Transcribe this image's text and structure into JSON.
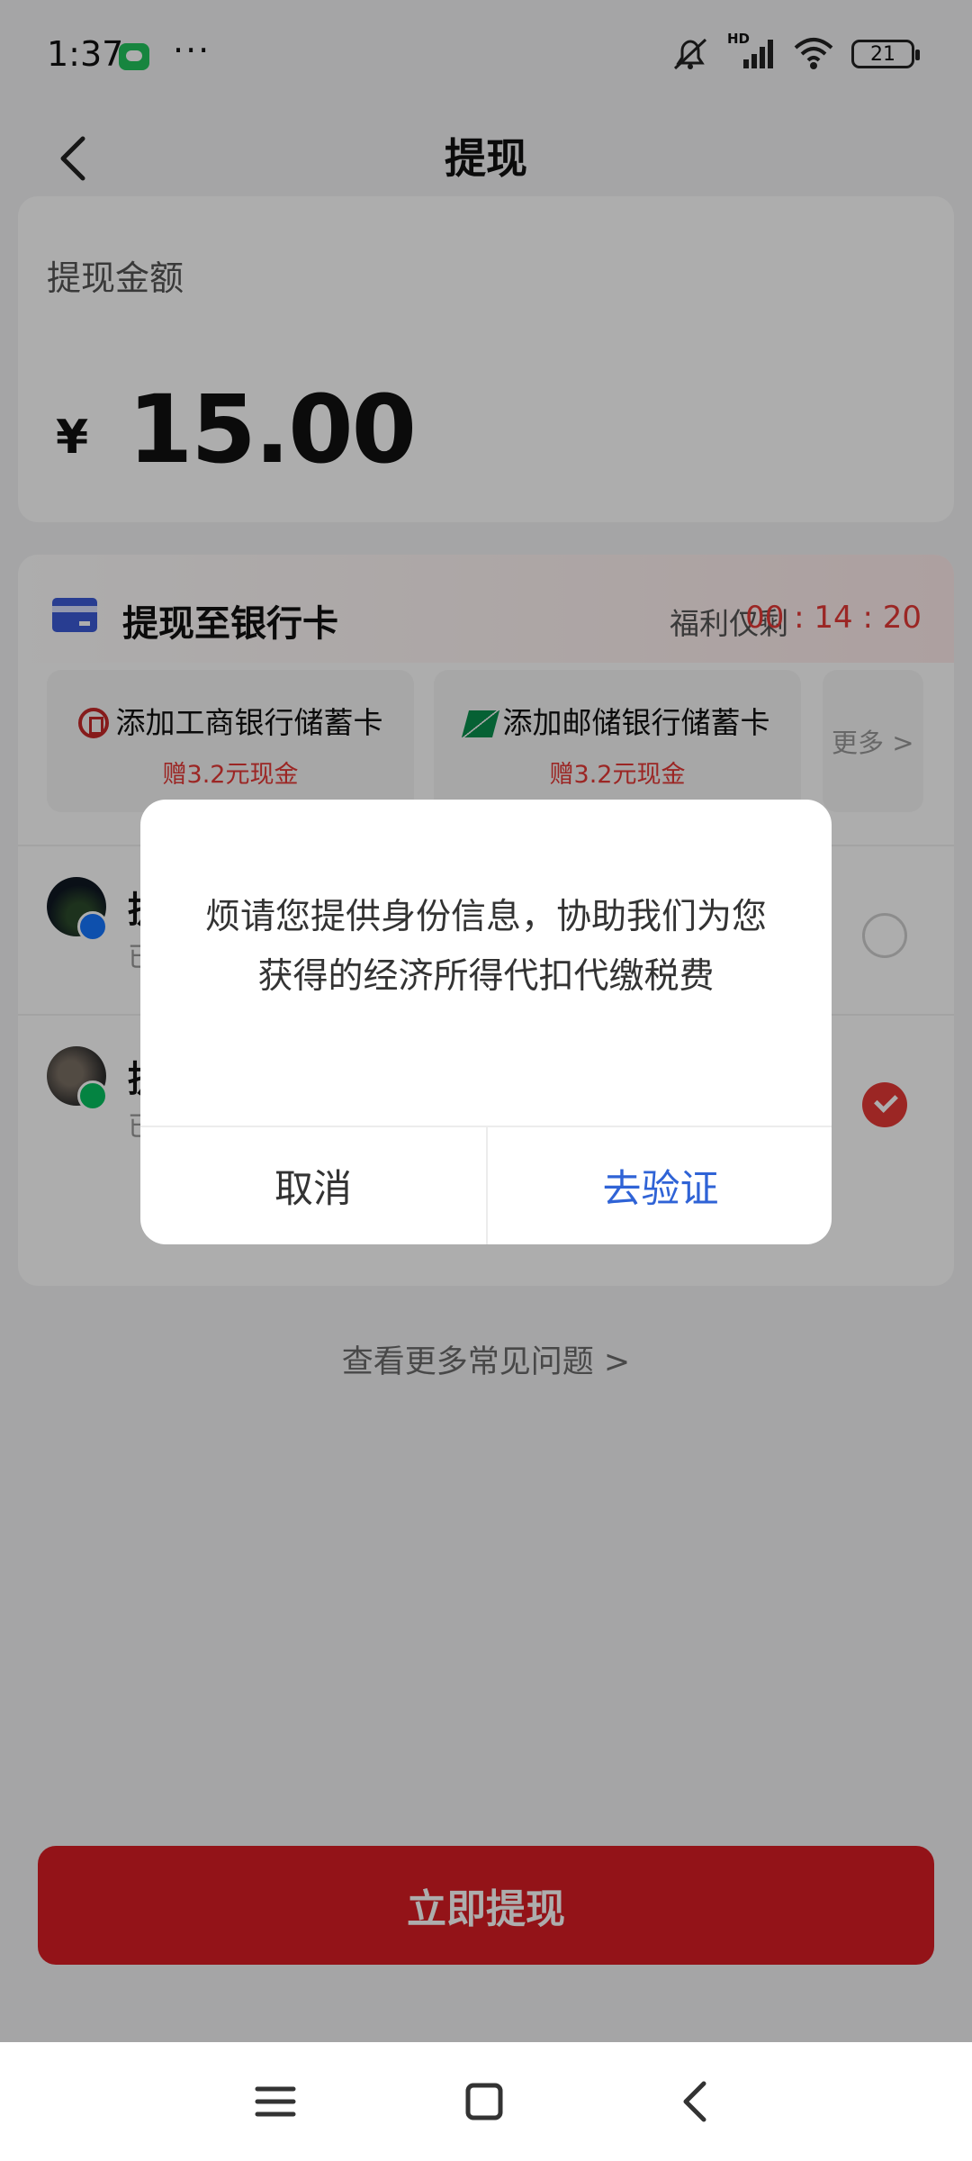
{
  "status_bar": {
    "time": "1:37",
    "more": "···",
    "battery": "21",
    "network_label": "HD",
    "icons": [
      "message-icon",
      "mute-icon",
      "signal-icon",
      "wifi-icon",
      "battery-icon"
    ]
  },
  "header": {
    "title": "提现"
  },
  "amount": {
    "label": "提现金额",
    "currency": "¥",
    "value": "15.00"
  },
  "bank_section": {
    "title": "提现至银行卡",
    "promo_label": "福利仅剩",
    "timer": "00 : 14 : 20",
    "banks": [
      {
        "name": "添加工商银行储蓄卡",
        "bonus": "赠3.2元现金"
      },
      {
        "name": "添加邮储银行储蓄卡",
        "bonus": "赠3.2元现金"
      }
    ],
    "more": "更多 >"
  },
  "accounts": [
    {
      "title": "提",
      "sub": "已",
      "selected": false
    },
    {
      "title": "提",
      "sub": "已",
      "selected": true
    }
  ],
  "faq": {
    "link": "查看更多常见问题 >"
  },
  "actions": {
    "withdraw": "立即提现"
  },
  "dialog": {
    "message": "烦请您提供身份信息，协助我们为您获得的经济所得代扣代缴税费",
    "cancel": "取消",
    "confirm": "去验证"
  },
  "colors": {
    "primary_red": "#d91d24",
    "accent_red": "#e53935",
    "link_blue": "#2f63d6"
  }
}
